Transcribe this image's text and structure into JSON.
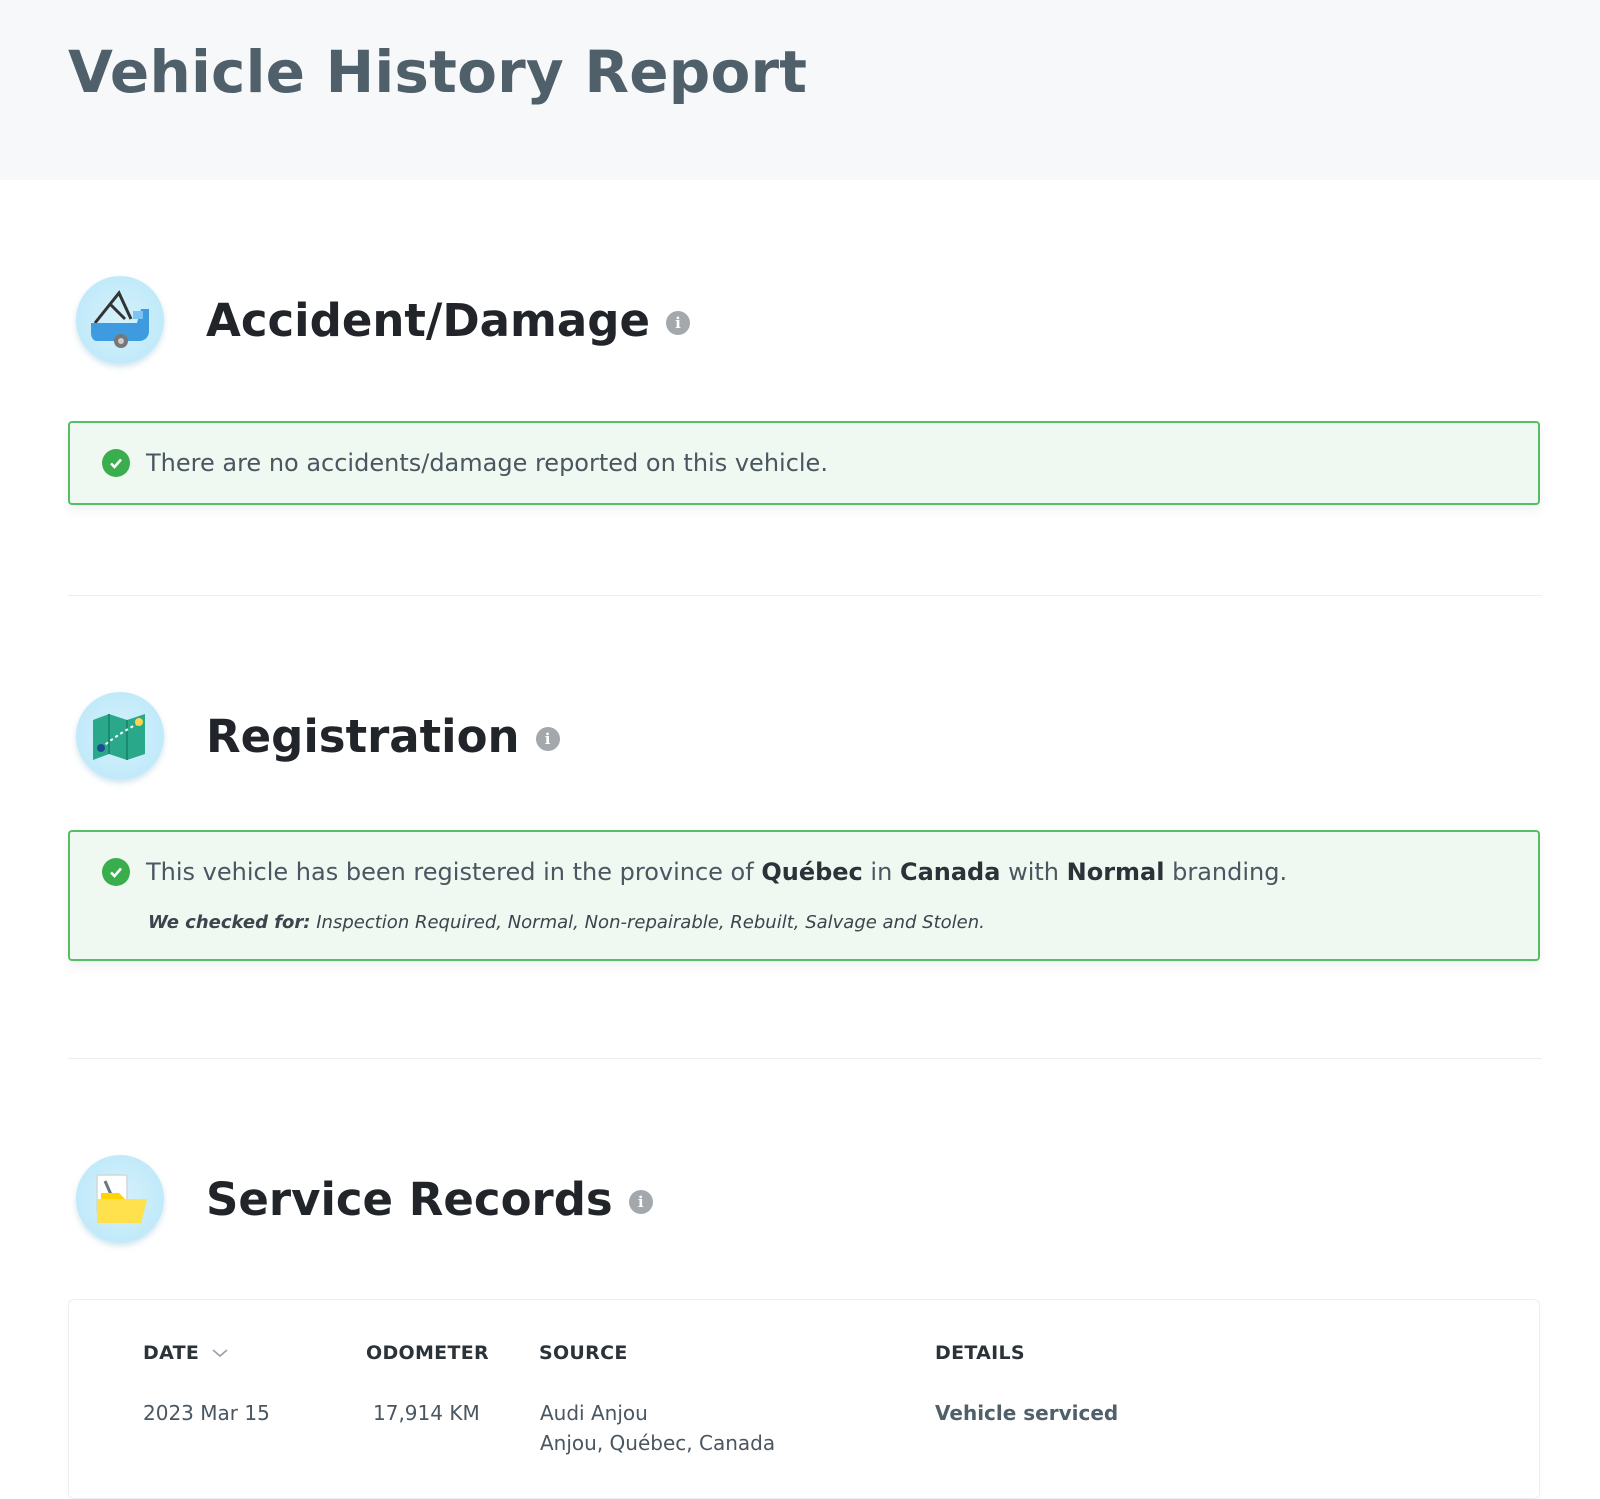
{
  "header": {
    "title": "Vehicle History Report"
  },
  "sections": {
    "accident": {
      "title": "Accident/Damage",
      "icon": "tow-truck-icon",
      "message": "There are no accidents/damage reported on this vehicle."
    },
    "registration": {
      "title": "Registration",
      "icon": "map-icon",
      "message_prefix": "This vehicle has been registered in the province of",
      "province": "Québec",
      "in_word": "in",
      "country": "Canada",
      "with_word": "with",
      "branding": "Normal",
      "suffix": "branding.",
      "checked_label": "We checked for:",
      "checked_list": "Inspection Required, Normal, Non-repairable, Rebuilt, Salvage and Stolen."
    },
    "service": {
      "title": "Service Records",
      "icon": "folder-wrench-icon",
      "columns": {
        "date": "DATE",
        "odometer": "ODOMETER",
        "source": "SOURCE",
        "details": "DETAILS"
      },
      "rows": [
        {
          "date": "2023 Mar 15",
          "odometer": "17,914 KM",
          "source_name": "Audi Anjou",
          "source_location": "Anjou, Québec, Canada",
          "details": "Vehicle serviced"
        }
      ]
    }
  },
  "colors": {
    "success_border": "#56bf66",
    "success_bg": "#f0f8f2",
    "check": "#3aae4d",
    "title": "#4f606b"
  }
}
